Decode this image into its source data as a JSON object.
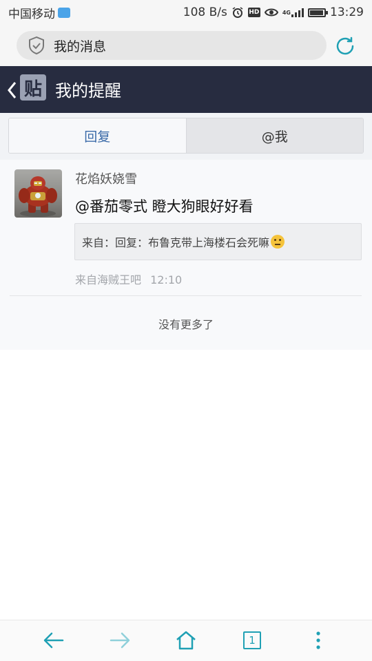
{
  "status_bar": {
    "carrier": "中国移动",
    "net_speed": "108 B/s",
    "time": "13:29",
    "hd_label": "HD",
    "network_label": "4G",
    "icons": [
      "app-notification-icon",
      "alarm-icon",
      "hd-icon",
      "eye-icon",
      "signal-icon",
      "battery-icon"
    ],
    "battery_level": 0.85
  },
  "address_bar": {
    "text": "我的消息",
    "icons": [
      "shield-icon",
      "refresh-icon"
    ]
  },
  "header": {
    "title": "我的提醒",
    "logo_text": "贴",
    "background": "#272c40"
  },
  "tabs": [
    {
      "label": "回复",
      "selected": false
    },
    {
      "label": "@我",
      "selected": true
    }
  ],
  "messages": [
    {
      "username": "花焰妖娆雪",
      "content": "@番茄零式 瞪大狗眼好好看",
      "quote": "来自：回复：布鲁克带上海楼石会死嘛",
      "quote_emoji": "thinking-face-emoji",
      "source": "来自海贼王吧",
      "time": "12:10"
    }
  ],
  "list_footer": "没有更多了",
  "bottom_nav": {
    "tab_count": "1",
    "icons": [
      "back-arrow-icon",
      "forward-arrow-icon",
      "home-icon",
      "tab-count-icon",
      "more-icon"
    ],
    "accent": "#1fa0b4"
  }
}
